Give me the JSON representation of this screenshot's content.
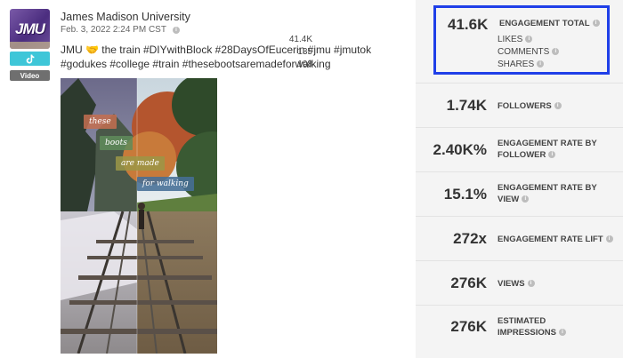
{
  "post": {
    "author": "James Madison University",
    "timestamp": "Feb. 3, 2022 2:24 PM CST",
    "caption": "JMU 🤝 the train #DIYwithBlock #28DaysOfEucerin #jmu #jmutok #godukes #college #train #thesebootsaremadeforwalking",
    "avatar_text": "JMU",
    "network_icon": "tiktok-icon",
    "media_type": "Video",
    "video_overlay": [
      "these",
      "boots",
      "are made",
      "for walking"
    ]
  },
  "metrics": {
    "engagement_total": {
      "value": "41.6K",
      "label": "ENGAGEMENT TOTAL",
      "breakdown": [
        {
          "value": "41.4K",
          "label": "LIKES"
        },
        {
          "value": "135",
          "label": "COMMENTS"
        },
        {
          "value": "108",
          "label": "SHARES"
        }
      ]
    },
    "rows": [
      {
        "value": "1.74K",
        "label": "FOLLOWERS"
      },
      {
        "value": "2.40K%",
        "label": "ENGAGEMENT RATE BY FOLLOWER"
      },
      {
        "value": "15.1%",
        "label": "ENGAGEMENT RATE BY VIEW"
      },
      {
        "value": "272x",
        "label": "ENGAGEMENT RATE LIFT"
      },
      {
        "value": "276K",
        "label": "VIEWS"
      },
      {
        "value": "276K",
        "label": "ESTIMATED IMPRESSIONS"
      }
    ]
  },
  "colors": {
    "highlight_border": "#1f3fe8",
    "tiktok_badge": "#3ec6d8",
    "avatar_purple": "#4b2d7f",
    "metrics_background": "#f4f4f4"
  }
}
